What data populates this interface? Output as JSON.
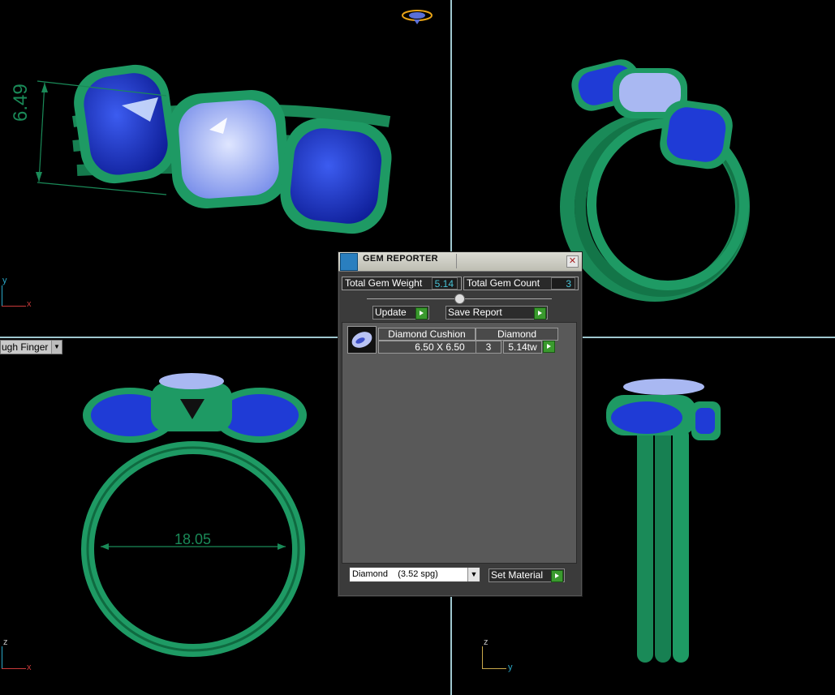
{
  "viewports": {
    "top_left": {
      "dimension": "6.49",
      "axis_vertical": "y",
      "axis_horizontal": "x"
    },
    "top_right": {},
    "bottom_left": {
      "dimension": "18.05",
      "axis_vertical": "z",
      "axis_horizontal": "x"
    },
    "bottom_right": {
      "axis_vertical": "z",
      "axis_horizontal": "y"
    },
    "view_dropdown": "ugh Finger"
  },
  "gem_reporter": {
    "title": "GEM REPORTER",
    "total_weight_label": "Total Gem Weight",
    "total_weight_value": "5.14",
    "total_count_label": "Total Gem Count",
    "total_count_value": "3",
    "update_label": "Update",
    "save_report_label": "Save Report",
    "gems": [
      {
        "name": "Diamond Cushion",
        "material": "Diamond",
        "size": "6.50 X 6.50",
        "count": "3",
        "weight": "5.14tw"
      }
    ],
    "material_select": "Diamond    (3.52 spg)",
    "set_material_label": "Set Material"
  },
  "colors": {
    "metal": "#1e8c5c",
    "gem_dark": "#1f3bd6",
    "gem_light": "#a9b8f2",
    "divider": "#9fc7cf",
    "value_text": "#48c3d6"
  }
}
